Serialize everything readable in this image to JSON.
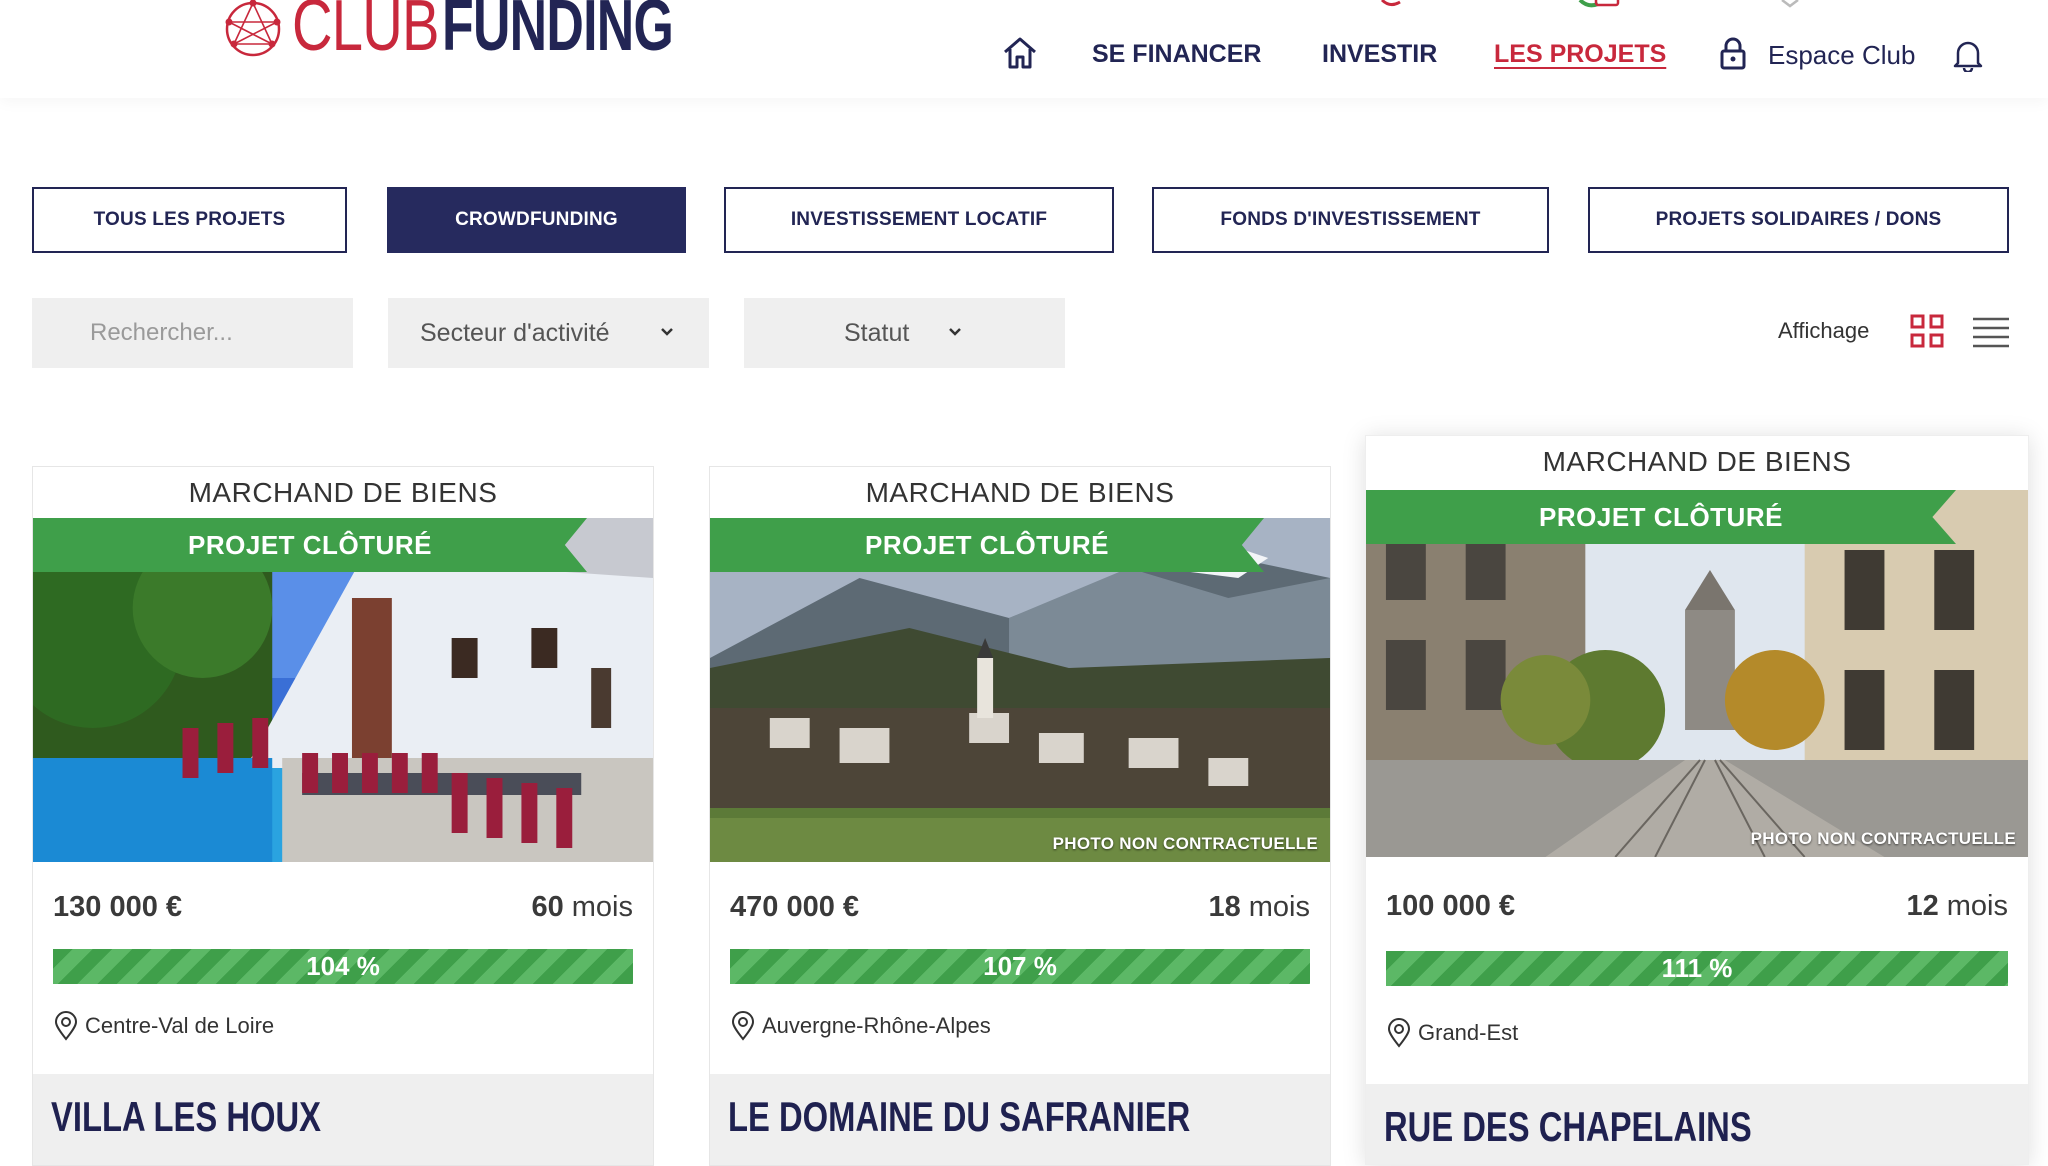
{
  "brand": {
    "club": "CLUB",
    "funding": "FUNDING"
  },
  "nav": {
    "home_icon": "home-icon",
    "items": [
      {
        "label": "SE FINANCER",
        "active": false
      },
      {
        "label": "INVESTIR",
        "active": false
      },
      {
        "label": "LES PROJETS",
        "active": true
      }
    ],
    "espace_label": "Espace Club",
    "lock_icon": "lock-icon",
    "bell_icon": "bell-icon"
  },
  "tabs": [
    {
      "label": "TOUS LES PROJETS",
      "active": false
    },
    {
      "label": "CROWDFUNDING",
      "active": true
    },
    {
      "label": "INVESTISSEMENT LOCATIF",
      "active": false
    },
    {
      "label": "FONDS D'INVESTISSEMENT",
      "active": false
    },
    {
      "label": "PROJETS SOLIDAIRES / DONS",
      "active": false
    }
  ],
  "filters": {
    "search_placeholder": "Rechercher...",
    "sector_label": "Secteur d'activité",
    "status_label": "Statut",
    "display_label": "Affichage"
  },
  "colors": {
    "navy": "#222554",
    "brand_red": "#c8283c",
    "banner_green": "#3f9f4a",
    "filter_bg": "#efefef"
  },
  "cards": [
    {
      "category": "MARCHAND DE BIENS",
      "banner": "PROJET CLÔTURÉ",
      "photo_note": "",
      "amount": "130 000 €",
      "duration_value": "60",
      "duration_unit": "mois",
      "progress_label": "104 %",
      "progress_percent": 104,
      "location": "Centre-Val de Loire",
      "title": "VILLA LES HOUX"
    },
    {
      "category": "MARCHAND DE BIENS",
      "banner": "PROJET CLÔTURÉ",
      "photo_note": "PHOTO NON CONTRACTUELLE",
      "amount": "470 000 €",
      "duration_value": "18",
      "duration_unit": "mois",
      "progress_label": "107 %",
      "progress_percent": 107,
      "location": "Auvergne-Rhône-Alpes",
      "title": "LE DOMAINE DU SAFRANIER"
    },
    {
      "category": "MARCHAND DE BIENS",
      "banner": "PROJET CLÔTURÉ",
      "photo_note": "PHOTO NON CONTRACTUELLE",
      "amount": "100 000 €",
      "duration_value": "12",
      "duration_unit": "mois",
      "progress_label": "111 %",
      "progress_percent": 111,
      "location": "Grand-Est",
      "title": "RUE DES CHAPELAINS"
    }
  ]
}
